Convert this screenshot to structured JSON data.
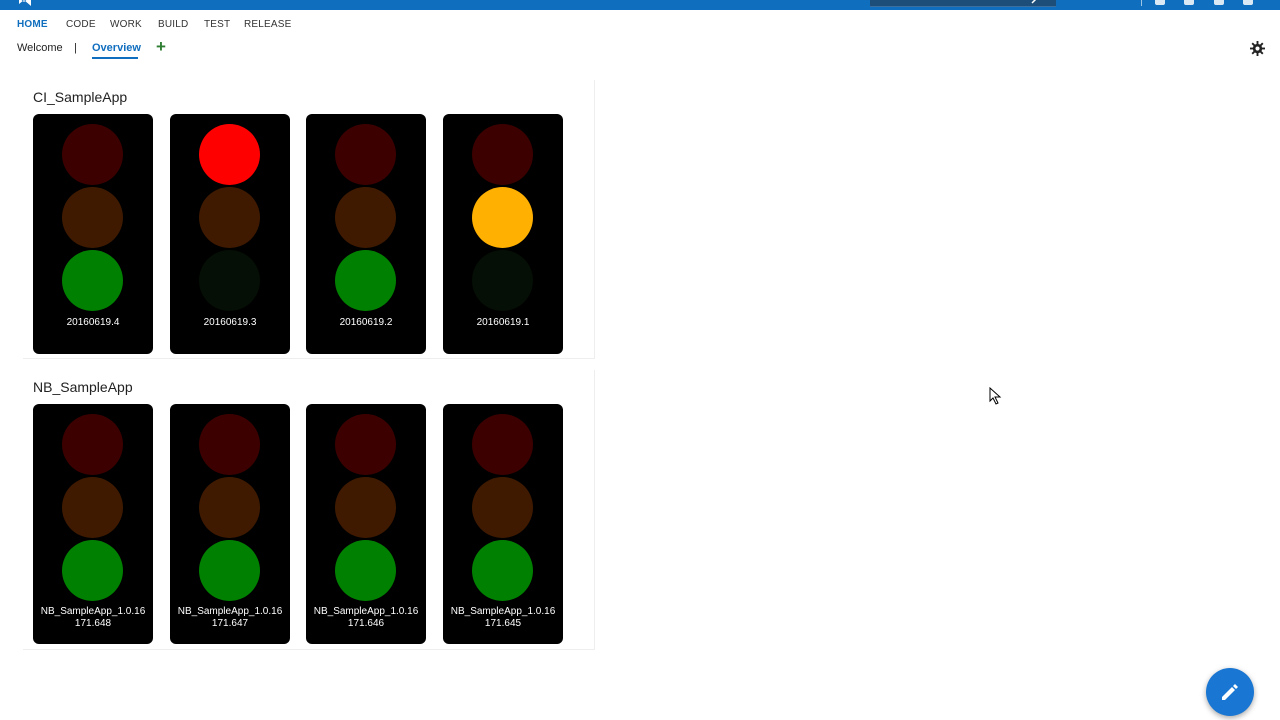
{
  "hub_nav": [
    "HOME",
    "CODE",
    "WORK",
    "BUILD",
    "TEST",
    "RELEASE"
  ],
  "hub_nav_active": "HOME",
  "dashboard_tabs": {
    "welcome": "Welcome",
    "separator": "|",
    "overview": "Overview",
    "active": "Overview",
    "add": "+"
  },
  "colors": {
    "accent": "#106ebe",
    "red_on": "#ff0000",
    "red_off": "#3d0000",
    "amber_on": "#ffb000",
    "amber_off": "#3f1a00",
    "green_on": "#008000",
    "green_off": "#050f05"
  },
  "icons": {
    "settings": "gear-icon",
    "edit": "pencil-icon",
    "add": "plus-icon"
  },
  "groups": [
    {
      "title": "CI_SampleApp",
      "lights": [
        {
          "label": "20160619.4",
          "state": "green"
        },
        {
          "label": "20160619.3",
          "state": "red"
        },
        {
          "label": "20160619.2",
          "state": "green"
        },
        {
          "label": "20160619.1",
          "state": "amber"
        }
      ]
    },
    {
      "title": "NB_SampleApp",
      "lights": [
        {
          "label": "NB_SampleApp_1.0.16\n171.648",
          "state": "green"
        },
        {
          "label": "NB_SampleApp_1.0.16\n171.647",
          "state": "green"
        },
        {
          "label": "NB_SampleApp_1.0.16\n171.646",
          "state": "green"
        },
        {
          "label": "NB_SampleApp_1.0.16\n171.645",
          "state": "green"
        }
      ]
    }
  ]
}
